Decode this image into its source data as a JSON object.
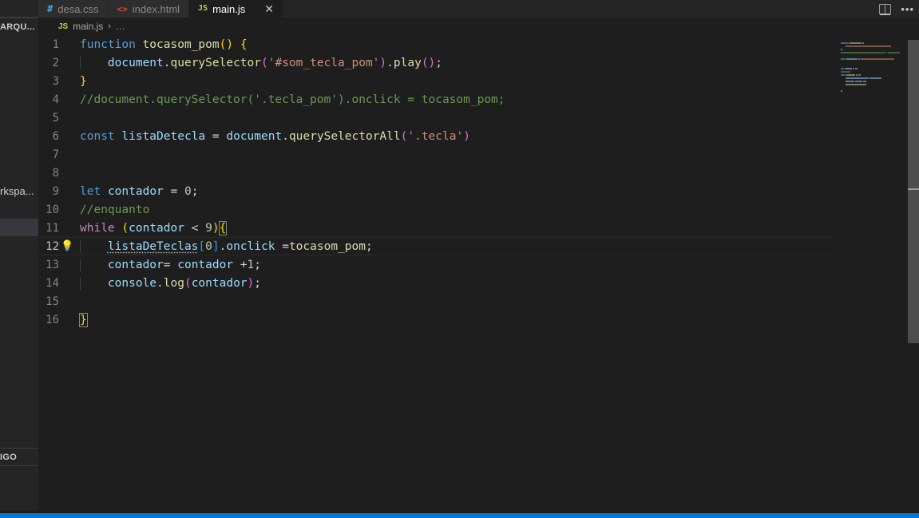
{
  "window": {
    "theme_bg": "#1e1e1e",
    "accent": "#0078d4"
  },
  "sidebar": {
    "explorer_title": "ARQU...",
    "workspace_label": "rkspa...",
    "section_label": "IGO",
    "selected_item": ""
  },
  "tabs": {
    "overflow_label": "…",
    "items": [
      {
        "label": "desa.css",
        "icon": "css-file-icon",
        "glyph": "#",
        "active": false,
        "closable": false
      },
      {
        "label": "index.html",
        "icon": "html-file-icon",
        "glyph": "<>",
        "active": false,
        "closable": false
      },
      {
        "label": "main.js",
        "icon": "js-file-icon",
        "glyph": "JS",
        "active": true,
        "closable": true
      }
    ],
    "close_glyph": "✕",
    "actions": {
      "split_editor": "split-editor-icon",
      "more_actions": "•••"
    }
  },
  "breadcrumb": {
    "icon_glyph": "JS",
    "file": "main.js",
    "separator": "›",
    "ellipsis": "…"
  },
  "editor": {
    "language": "javascript",
    "current_line": 12,
    "lightbulb_glyph": "💡",
    "lines": [
      {
        "n": 1,
        "text": "function tocasom_pom() {"
      },
      {
        "n": 2,
        "text": "    document.querySelector('#som_tecla_pom').play();"
      },
      {
        "n": 3,
        "text": "}"
      },
      {
        "n": 4,
        "text": "//document.querySelector('.tecla_pom').onclick = tocasom_pom;"
      },
      {
        "n": 5,
        "text": ""
      },
      {
        "n": 6,
        "text": "const listaDetecla = document.querySelectorAll('.tecla')"
      },
      {
        "n": 7,
        "text": ""
      },
      {
        "n": 8,
        "text": ""
      },
      {
        "n": 9,
        "text": "let contador = 0;"
      },
      {
        "n": 10,
        "text": "//enquanto"
      },
      {
        "n": 11,
        "text": "while (contador < 9){"
      },
      {
        "n": 12,
        "text": "    listaDeTeclas[0].onclick =tocasom_pom;"
      },
      {
        "n": 13,
        "text": "    contador= contador +1;"
      },
      {
        "n": 14,
        "text": "    console.log(contador);"
      },
      {
        "n": 15,
        "text": ""
      },
      {
        "n": 16,
        "text": "}"
      }
    ]
  },
  "minimap": {
    "present": true
  },
  "scrollbar": {
    "present": true
  }
}
